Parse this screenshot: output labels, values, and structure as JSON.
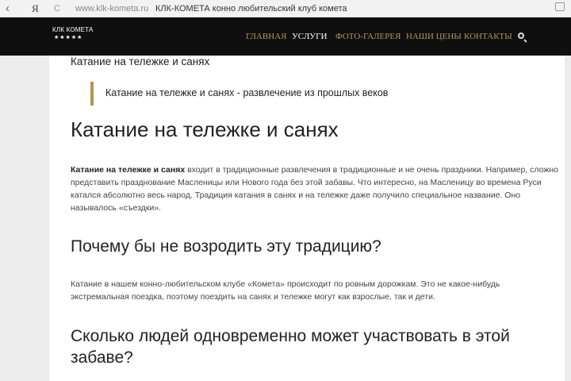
{
  "browser": {
    "back_glyph": "‹",
    "yandex_glyph": "Я",
    "reload_glyph": "C",
    "url": "www.klk-kometa.ru",
    "page_title": "КЛК-КОМЕТА конно любительский клуб комета"
  },
  "header": {
    "logo_name": "КЛК КОМЕТА",
    "logo_stars": "★★★★★",
    "nav": [
      "ГЛАВНАЯ",
      "УСЛУГИ",
      "ФОТО-ГАЛЕРЕЯ",
      "НАШИ ЦЕНЫ",
      "КОНТАКТЫ"
    ],
    "active_nav": "УСЛУГИ"
  },
  "colors": {
    "header_bg": "#0f0f0f",
    "nav_text": "#b49452",
    "nav_active": "#ffffff",
    "quote_bar": "#b49452",
    "page_bg": "#ececec",
    "content_bg": "#ffffff"
  },
  "icons": {
    "search": "search-icon",
    "back": "back-arrow-icon",
    "reload": "reload-icon",
    "extension": "extension-icon"
  },
  "content": {
    "breadcrumb_title": "Катание на тележке и санях",
    "quote": "Катание на тележке и санях - развлечение из прошлых веков",
    "h1": "Катание на тележке и санях",
    "intro_bold": "Катание на тележке и санях",
    "intro_rest": " входит в традиционные развлечения в традиционные и не очень праздники. Например, сложно представить празднование Масленицы или Нового года без этой забавы. Что интересно, на Масленицу во времена Руси катался абсолютно весь народ. Традиция катания в санях и на тележке даже получило специальное название. Оно называлось «съездки».",
    "h2_first": "Почему бы не возродить эту традицию?",
    "para2": "Катание в нашем конно-любительском клубе «Комета» происходит по ровным дорожкам. Это не какое-нибудь экстремальная поездка, поэтому поездить на санях и тележке могут как взрослые, так и дети.",
    "h2_second": "Сколько людей одновременно может участвовать в этой забаве?"
  }
}
